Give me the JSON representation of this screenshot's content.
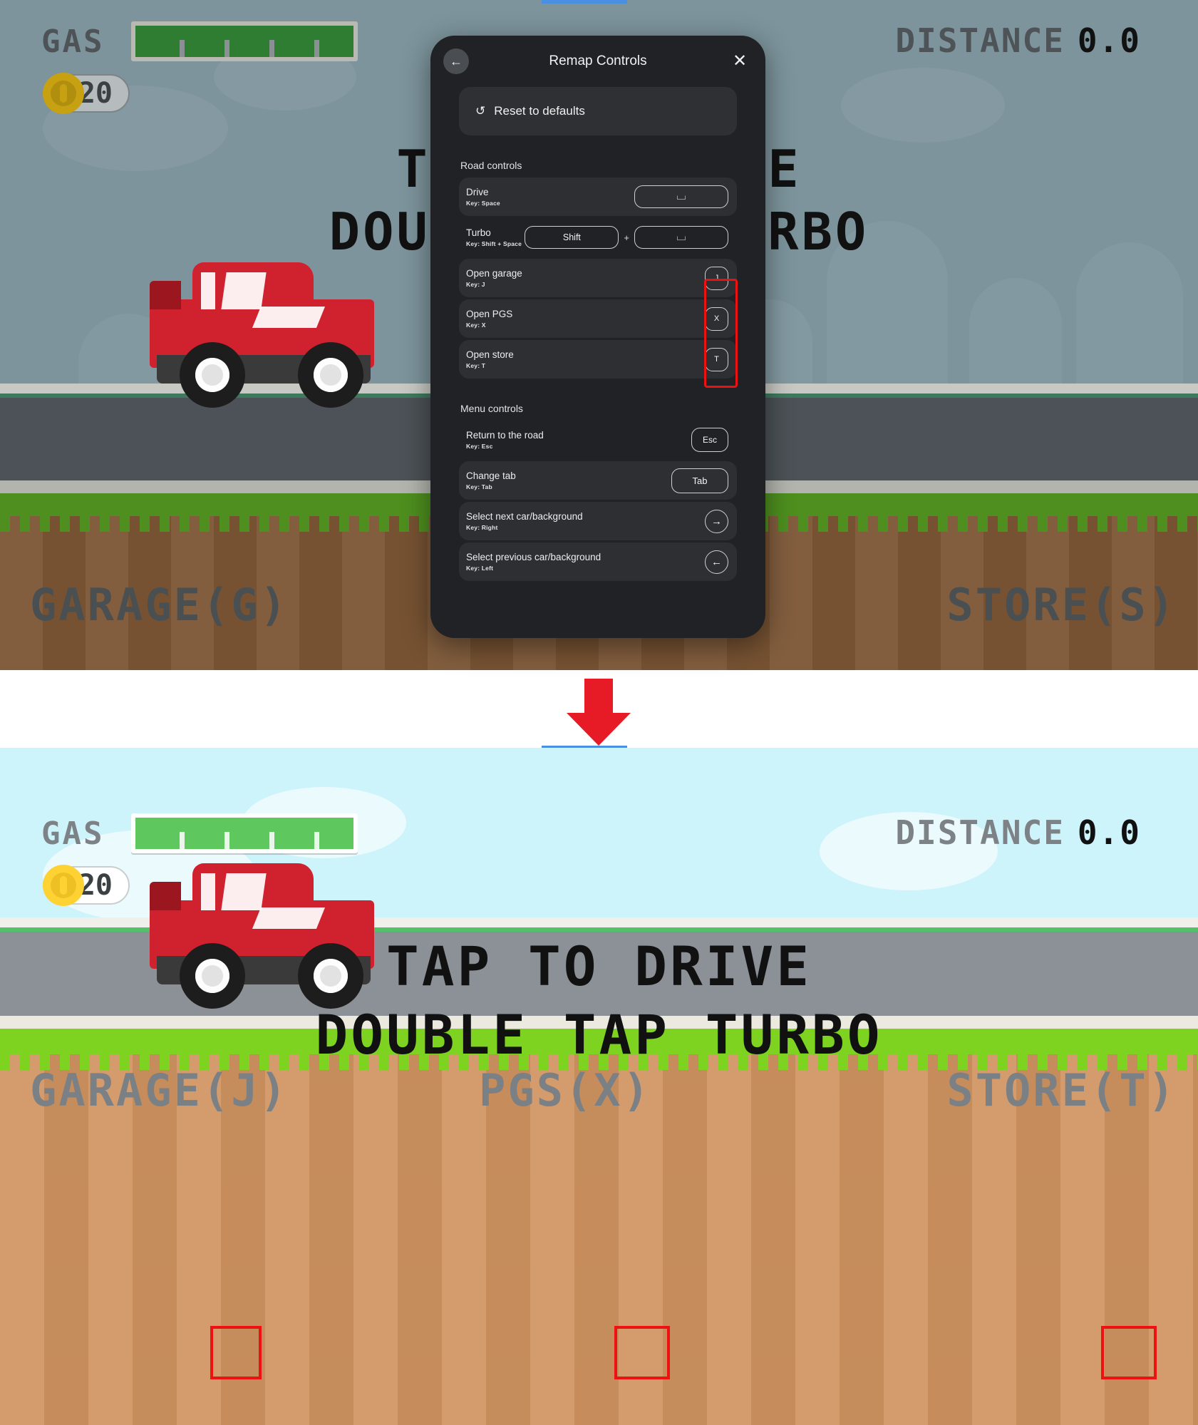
{
  "game": {
    "gas_label": "GAS",
    "coins": "20",
    "distance_label": "DISTANCE",
    "distance_value": "0.0",
    "tap_line1": "TAP TO DRIVE",
    "tap_line2": "DOUBLE TAP TURBO",
    "top_panel": {
      "garage_label": "GARAGE(G)",
      "store_label": "STORE(S)"
    },
    "bottom_panel": {
      "garage_label": "GARAGE(J)",
      "pgs_label": "PGS(X)",
      "store_label": "STORE(T)"
    }
  },
  "modal": {
    "title": "Remap Controls",
    "back_icon": "←",
    "close_icon": "✕",
    "reset": {
      "icon": "↺",
      "label": "Reset to defaults"
    },
    "sections": [
      {
        "title": "Road controls",
        "rows": [
          {
            "name": "Drive",
            "key_sub": "Key: Space",
            "keys": [
              "⌴"
            ],
            "shaded": true,
            "wide": true
          },
          {
            "name": "Turbo",
            "key_sub": "Key: Shift + Space",
            "keys": [
              "Shift",
              "⌴"
            ],
            "shaded": false,
            "wide": true
          },
          {
            "name": "Open garage",
            "key_sub": "Key: J",
            "keys": [
              "J"
            ],
            "shaded": true,
            "wide": false
          },
          {
            "name": "Open PGS",
            "key_sub": "Key: X",
            "keys": [
              "X"
            ],
            "shaded": true,
            "wide": false
          },
          {
            "name": "Open store",
            "key_sub": "Key: T",
            "keys": [
              "T"
            ],
            "shaded": true,
            "wide": false
          }
        ]
      },
      {
        "title": "Menu controls",
        "rows": [
          {
            "name": "Return to the road",
            "key_sub": "Key: Esc",
            "keys": [
              "Esc"
            ],
            "shaded": false
          },
          {
            "name": "Change tab",
            "key_sub": "Key: Tab",
            "keys": [
              "Tab"
            ],
            "shaded": true
          },
          {
            "name": "Select next car/background",
            "key_sub": "Key: Right",
            "keys": [
              "→"
            ],
            "shaded": true
          },
          {
            "name": "Select previous car/background",
            "key_sub": "Key: Left",
            "keys": [
              "←"
            ],
            "shaded": true
          }
        ]
      }
    ]
  },
  "annotations": {
    "arrow_color": "#e71b25",
    "highlight_color": "#ee1111"
  }
}
